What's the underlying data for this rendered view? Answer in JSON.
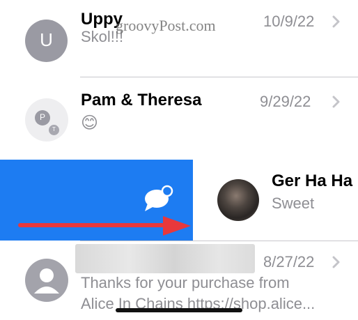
{
  "watermark": "groovyPost.com",
  "conversations": [
    {
      "name": "Uppy",
      "preview": "Skol!!!",
      "date": "10/9/22",
      "avatar_initial": "U"
    },
    {
      "name": "Pam & Theresa",
      "preview": "😊",
      "date": "9/29/22",
      "avatar_initials": [
        "P",
        "T"
      ]
    },
    {
      "name": "Ger Ha Ha",
      "preview": "Sweet",
      "swipe_action": "mark-unread-icon"
    },
    {
      "name": "",
      "preview": "Thanks for your purchase from",
      "preview_line2": "Alice In Chains https://shop.alice...",
      "date": "8/27/22"
    }
  ],
  "colors": {
    "swipe_action": "#1d7cf2",
    "arrow": "#e8383c",
    "divider": "#c8c7cc",
    "secondary_text": "#8e8e93"
  }
}
